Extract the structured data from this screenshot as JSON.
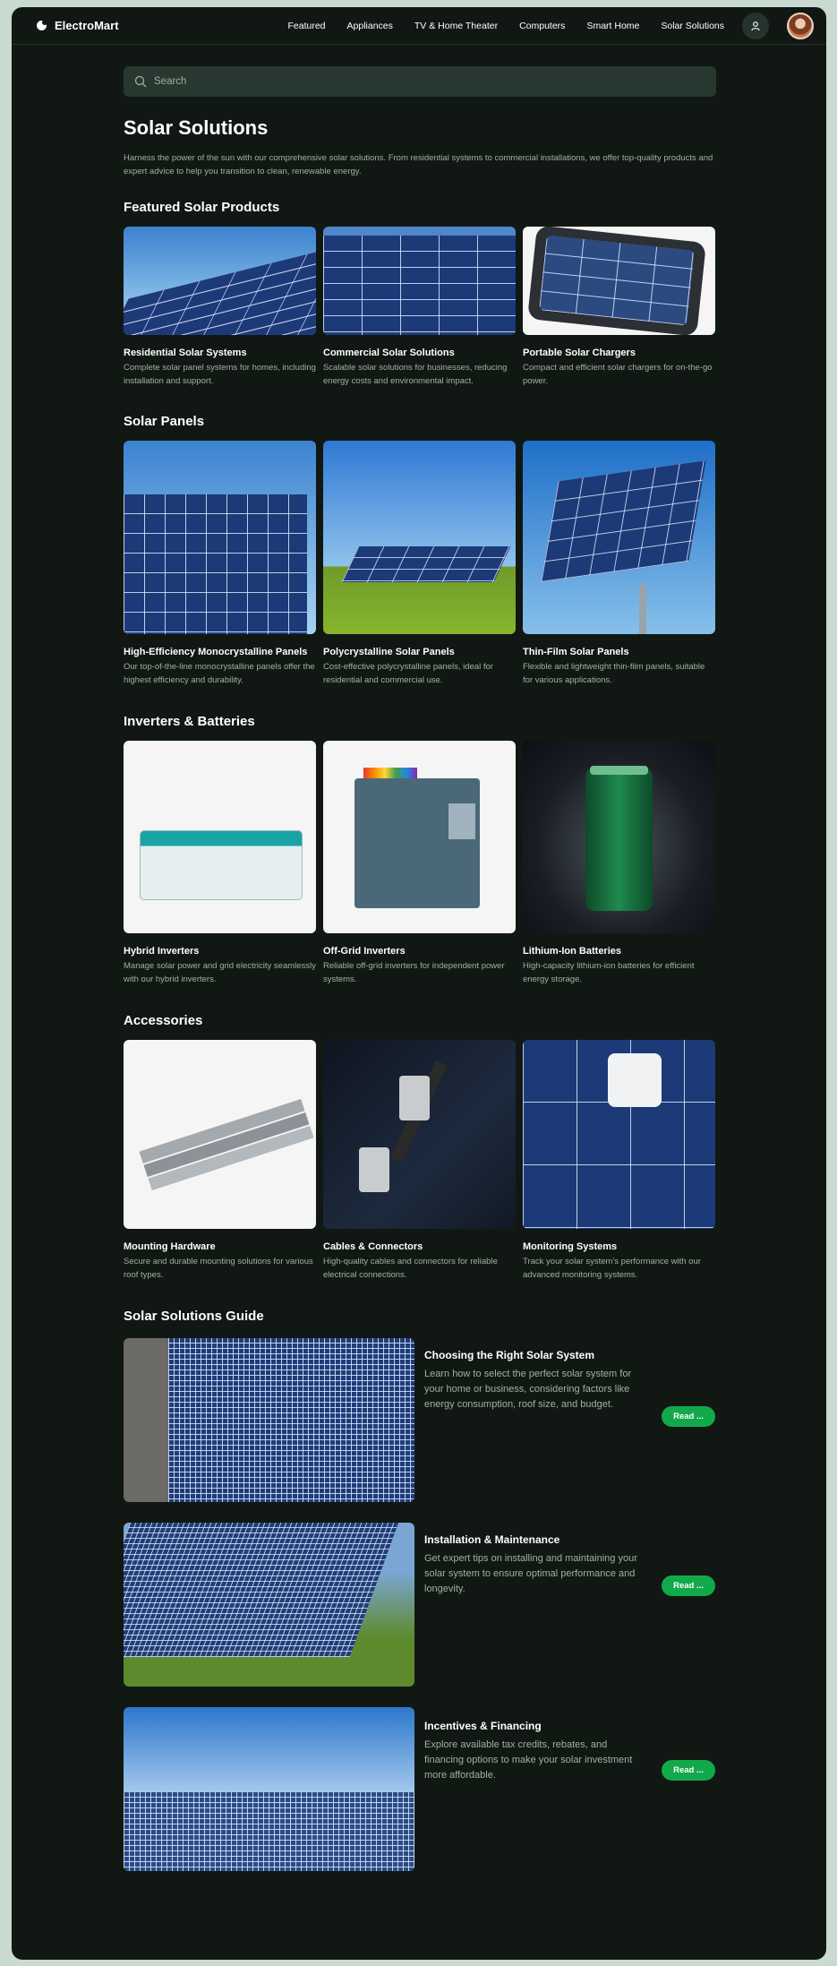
{
  "header": {
    "brand": "ElectroMart",
    "nav": [
      "Featured",
      "Appliances",
      "TV & Home Theater",
      "Computers",
      "Smart Home",
      "Solar Solutions"
    ]
  },
  "search": {
    "placeholder": "Search"
  },
  "page": {
    "title": "Solar Solutions",
    "intro": "Harness the power of the sun with our comprehensive solar solutions. From residential systems to commercial installations, we offer top-quality products and expert advice to help you transition to clean, renewable energy."
  },
  "featured": {
    "title": "Featured Solar Products",
    "items": [
      {
        "title": "Residential Solar Systems",
        "desc": "Complete solar panel systems for homes, including installation and support."
      },
      {
        "title": "Commercial Solar Solutions",
        "desc": "Scalable solar solutions for businesses, reducing energy costs and environmental impact."
      },
      {
        "title": "Portable Solar Chargers",
        "desc": "Compact and efficient solar chargers for on-the-go power."
      }
    ]
  },
  "panels": {
    "title": "Solar Panels",
    "items": [
      {
        "title": "High-Efficiency Monocrystalline Panels",
        "desc": "Our top-of-the-line monocrystalline panels offer the highest efficiency and durability."
      },
      {
        "title": "Polycrystalline Solar Panels",
        "desc": "Cost-effective polycrystalline panels, ideal for residential and commercial use."
      },
      {
        "title": "Thin-Film Solar Panels",
        "desc": "Flexible and lightweight thin-film panels, suitable for various applications."
      }
    ]
  },
  "inverters": {
    "title": "Inverters & Batteries",
    "items": [
      {
        "title": "Hybrid Inverters",
        "desc": "Manage solar power and grid electricity seamlessly with our hybrid inverters."
      },
      {
        "title": "Off-Grid Inverters",
        "desc": "Reliable off-grid inverters for independent power systems."
      },
      {
        "title": "Lithium-Ion Batteries",
        "desc": "High-capacity lithium-ion batteries for efficient energy storage."
      }
    ]
  },
  "accessories": {
    "title": "Accessories",
    "items": [
      {
        "title": "Mounting Hardware",
        "desc": "Secure and durable mounting solutions for various roof types."
      },
      {
        "title": "Cables & Connectors",
        "desc": "High-quality cables and connectors for reliable electrical connections."
      },
      {
        "title": "Monitoring Systems",
        "desc": "Track your solar system's performance with our advanced monitoring systems."
      }
    ]
  },
  "guide": {
    "title": "Solar Solutions Guide",
    "items": [
      {
        "title": "Choosing the Right Solar System",
        "desc": "Learn how to select the perfect solar system for your home or business, considering factors like energy consumption, roof size, and budget.",
        "button": "Read ..."
      },
      {
        "title": "Installation & Maintenance",
        "desc": "Get expert tips on installing and maintaining your solar system to ensure optimal performance and longevity.",
        "button": "Read ..."
      },
      {
        "title": "Incentives & Financing",
        "desc": "Explore available tax credits, rebates, and financing options to make your solar investment more affordable.",
        "button": "Read ..."
      }
    ]
  },
  "colors": {
    "background": "#111813",
    "accent": "#12a94b",
    "muted_text": "#9eb1a6",
    "search_bg": "#26382f"
  }
}
